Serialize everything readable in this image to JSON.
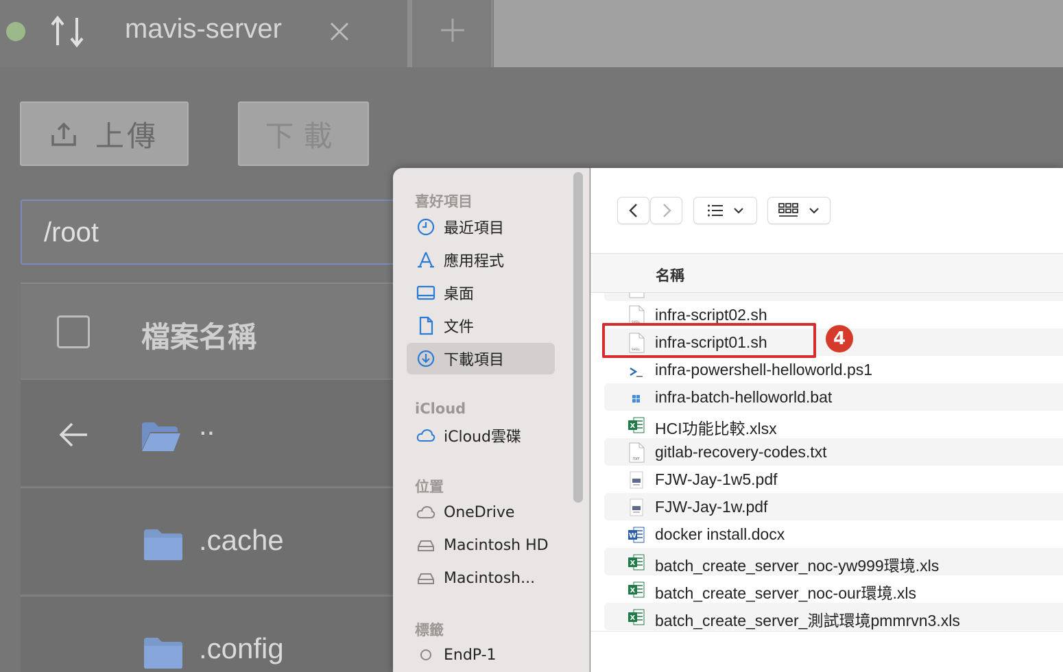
{
  "tab": {
    "title": "mavis-server"
  },
  "toolbar": {
    "upload_label": "上傳",
    "download_label": "下載"
  },
  "path": {
    "value": "/root"
  },
  "table": {
    "header": "檔案名稱",
    "rows": [
      {
        "name": "..",
        "icon": "folder-open-icon"
      },
      {
        "name": ".cache",
        "icon": "folder-icon"
      },
      {
        "name": ".config",
        "icon": "folder-icon"
      }
    ]
  },
  "dialog": {
    "sidebar": {
      "favorites_heading": "喜好項目",
      "favorites": [
        "最近項目",
        "應用程式",
        "桌面",
        "文件",
        "下載項目"
      ],
      "icloud_heading": "iCloud",
      "icloud": [
        "iCloud雲碟"
      ],
      "locations_heading": "位置",
      "locations": [
        "OneDrive",
        "Macintosh HD",
        "Macintosh..."
      ],
      "tags_heading": "標籤",
      "tags": [
        "EndP-1"
      ]
    },
    "column_name": "名稱",
    "files": [
      {
        "name": "infra-script02.sh",
        "icon": "shell-file-icon"
      },
      {
        "name": "infra-script01.sh",
        "icon": "shell-file-icon"
      },
      {
        "name": "infra-powershell-helloworld.ps1",
        "icon": "powershell-icon"
      },
      {
        "name": "infra-batch-helloworld.bat",
        "icon": "batch-file-icon"
      },
      {
        "name": "HCI功能比較.xlsx",
        "icon": "excel-icon"
      },
      {
        "name": "gitlab-recovery-codes.txt",
        "icon": "text-file-icon"
      },
      {
        "name": "FJW-Jay-1w5.pdf",
        "icon": "pdf-file-icon"
      },
      {
        "name": "FJW-Jay-1w.pdf",
        "icon": "pdf-file-icon"
      },
      {
        "name": "docker install.docx",
        "icon": "word-icon"
      },
      {
        "name": "batch_create_server_noc-yw999環境.xls",
        "icon": "excel-icon"
      },
      {
        "name": "batch_create_server_noc-our環境.xls",
        "icon": "excel-icon"
      },
      {
        "name": "batch_create_server_測試環境pmmrvn3.xls",
        "icon": "excel-icon"
      }
    ]
  },
  "annotation": {
    "step": "4"
  },
  "colors": {
    "highlight": "#d82c2c",
    "badge": "#d63a2a",
    "folder": "#7b9acc",
    "accent": "#2a7bd6"
  }
}
